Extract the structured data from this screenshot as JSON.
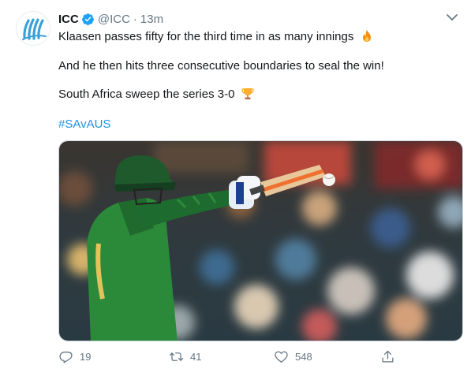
{
  "tweet": {
    "name": "ICC",
    "handle": "@ICC",
    "separator": "·",
    "time": "13m",
    "lines": [
      "Klaasen passes fifty for the third time in as many innings",
      "And he then hits three consecutive boundaries to seal the win!",
      "South Africa sweep the series 3-0"
    ],
    "hashtag": "#SAvAUS",
    "media_alt": "Heinrich Klaasen batting in a green and gold South Africa kit"
  },
  "actions": {
    "replies": "19",
    "retweets": "41",
    "likes": "548"
  },
  "colors": {
    "link": "#1b95e0",
    "verified": "#1da1f2",
    "muted": "#657786",
    "text": "#14171a",
    "logo_blue": "#3aa0d8"
  },
  "icons": {
    "avatar": "icc-logo-icon",
    "verified": "verified-badge-icon",
    "menu": "chevron-down-icon",
    "emoji1": "fire-emoji-icon",
    "emoji2": "trophy-emoji-icon",
    "reply": "reply-icon",
    "retweet": "retweet-icon",
    "like": "heart-icon",
    "share": "share-icon"
  }
}
